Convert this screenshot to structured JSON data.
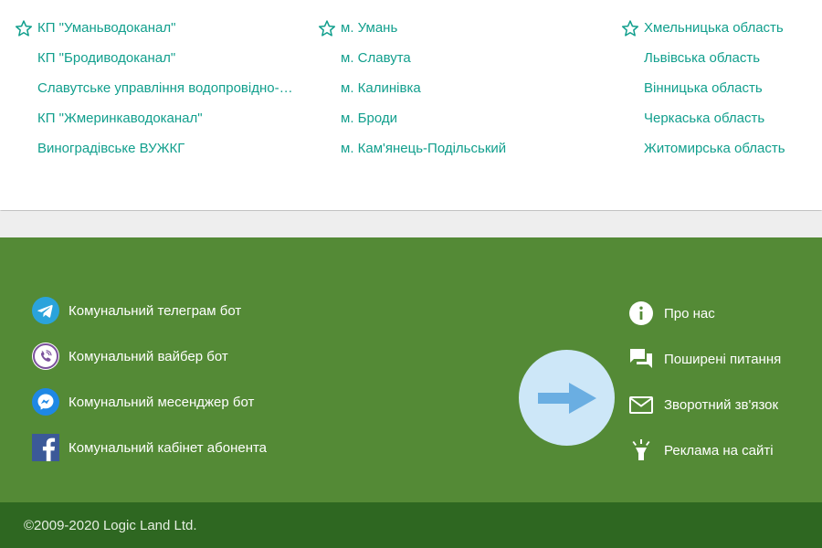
{
  "colors": {
    "link": "#119f8d",
    "footer_bg": "#548a36",
    "bottom_bg": "#2e6721",
    "gap_bg": "#eeeeee",
    "arrow_circle": "#cde7f8",
    "arrow": "#6aaee2"
  },
  "favorites": {
    "enterprises": [
      {
        "label": "КП \"Уманьводоканал\"",
        "starred": true
      },
      {
        "label": "КП \"Бродиводоканал\"",
        "starred": false
      },
      {
        "label": "Славутське управління водопровідно-…",
        "starred": false
      },
      {
        "label": "КП \"Жмеринкаводоканал\"",
        "starred": false
      },
      {
        "label": "Виноградівське ВУЖКГ",
        "starred": false
      }
    ],
    "cities": [
      {
        "label": "м. Умань",
        "starred": true
      },
      {
        "label": "м. Славута",
        "starred": false
      },
      {
        "label": "м. Калинівка",
        "starred": false
      },
      {
        "label": "м. Броди",
        "starred": false
      },
      {
        "label": "м. Кам'янець-Подільський",
        "starred": false
      }
    ],
    "regions": [
      {
        "label": "Хмельницька область",
        "starred": true
      },
      {
        "label": "Львівська область",
        "starred": false
      },
      {
        "label": "Вінницька область",
        "starred": false
      },
      {
        "label": "Черкаська область",
        "starred": false
      },
      {
        "label": "Житомирська область",
        "starred": false
      }
    ]
  },
  "footer": {
    "bots": [
      {
        "label": "Комунальний телеграм бот",
        "icon": "telegram-icon"
      },
      {
        "label": "Комунальний вайбер бот",
        "icon": "viber-icon"
      },
      {
        "label": "Комунальний месенджер бот",
        "icon": "messenger-icon"
      },
      {
        "label": "Комунальний кабінет абонента",
        "icon": "facebook-icon"
      }
    ],
    "links": [
      {
        "label": "Про нас",
        "icon": "info-icon"
      },
      {
        "label": "Поширені питання",
        "icon": "faq-icon"
      },
      {
        "label": "Зворотний зв'язок",
        "icon": "mail-icon"
      },
      {
        "label": "Реклама на сайті",
        "icon": "spotlight-icon"
      }
    ],
    "arrow_icon": "arrow-right-icon",
    "copyright": "©2009-2020 Logic Land Ltd."
  }
}
